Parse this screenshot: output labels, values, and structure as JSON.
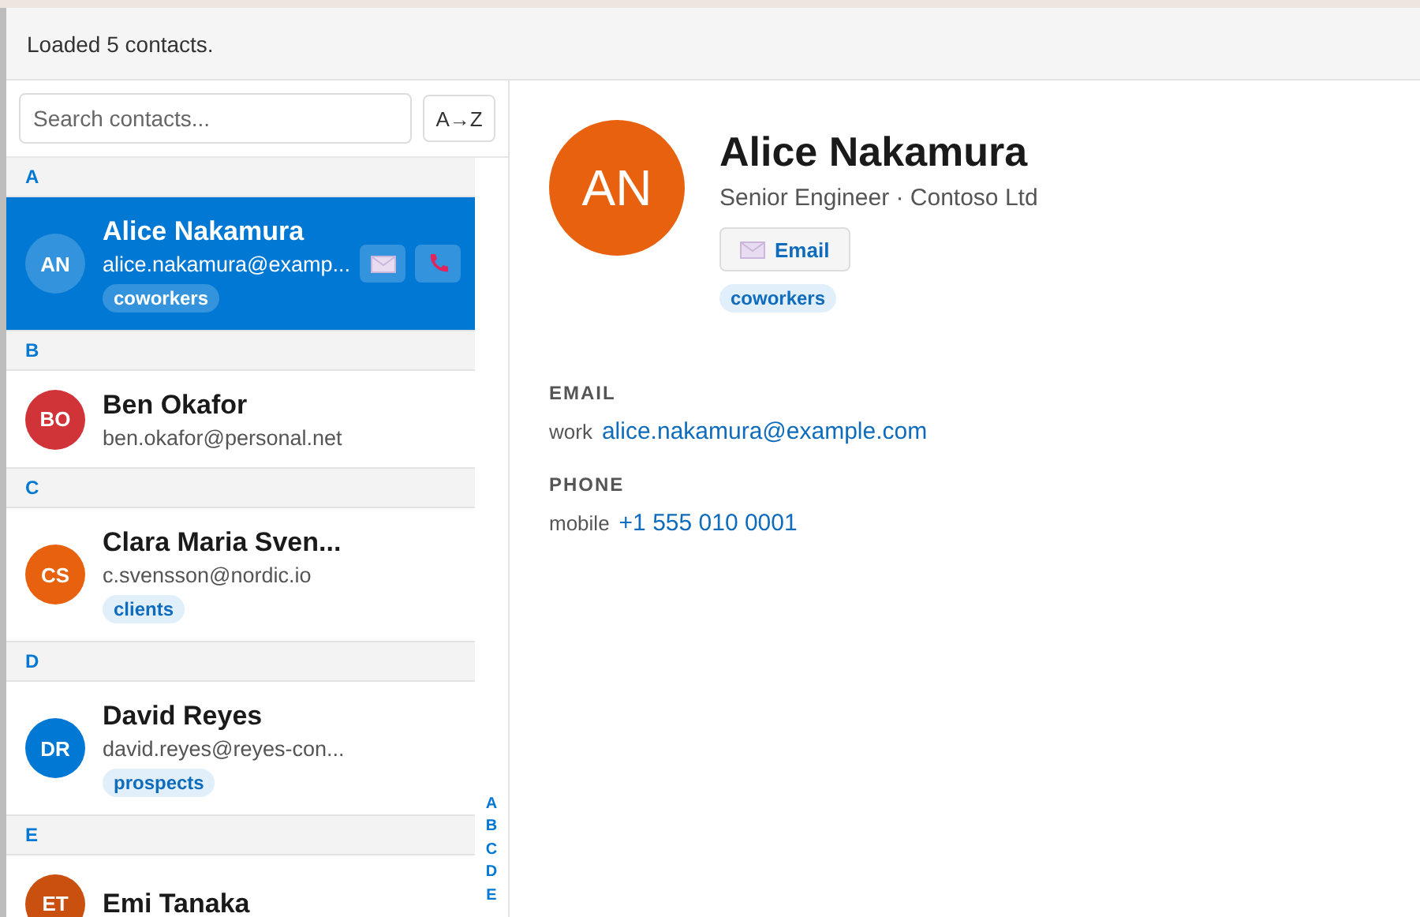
{
  "status_bar": {
    "text": "Loaded 5 contacts."
  },
  "search": {
    "placeholder": "Search contacts..."
  },
  "sort_button": {
    "label": "A→Z"
  },
  "groups": [
    {
      "letter": "A",
      "contacts": [
        {
          "initials": "AN",
          "name": "Alice Nakamura",
          "email": "alice.nakamura@examp...",
          "tags": [
            "coworkers"
          ],
          "selected": true
        }
      ]
    },
    {
      "letter": "B",
      "contacts": [
        {
          "initials": "BO",
          "name": "Ben Okafor",
          "email": "ben.okafor@personal.net",
          "color": "#d13438",
          "selected": false
        }
      ]
    },
    {
      "letter": "C",
      "contacts": [
        {
          "initials": "CS",
          "name": "Clara Maria Sven...",
          "email": "c.svensson@nordic.io",
          "tags": [
            "clients"
          ],
          "color": "#e8610f",
          "selected": false
        }
      ]
    },
    {
      "letter": "D",
      "contacts": [
        {
          "initials": "DR",
          "name": "David Reyes",
          "email": "david.reyes@reyes-con...",
          "tags": [
            "prospects"
          ],
          "color": "#0078d4",
          "selected": false
        }
      ]
    },
    {
      "letter": "E",
      "contacts": [
        {
          "initials": "ET",
          "name": "Emi Tanaka",
          "color": "#ca5010",
          "selected": false
        }
      ]
    }
  ],
  "alphabet_index": [
    "A",
    "B",
    "C",
    "D",
    "E"
  ],
  "detail": {
    "initials": "AN",
    "color": "#e8610f",
    "name": "Alice Nakamura",
    "subtitle": "Senior Engineer · Contoso Ltd",
    "email_button": "Email",
    "tags": [
      "coworkers"
    ],
    "sections": [
      {
        "label": "EMAIL",
        "entries": [
          {
            "type": "work",
            "value": "alice.nakamura@example.com"
          }
        ]
      },
      {
        "label": "PHONE",
        "entries": [
          {
            "type": "mobile",
            "value": "+1 555 010 0001"
          }
        ]
      }
    ]
  }
}
